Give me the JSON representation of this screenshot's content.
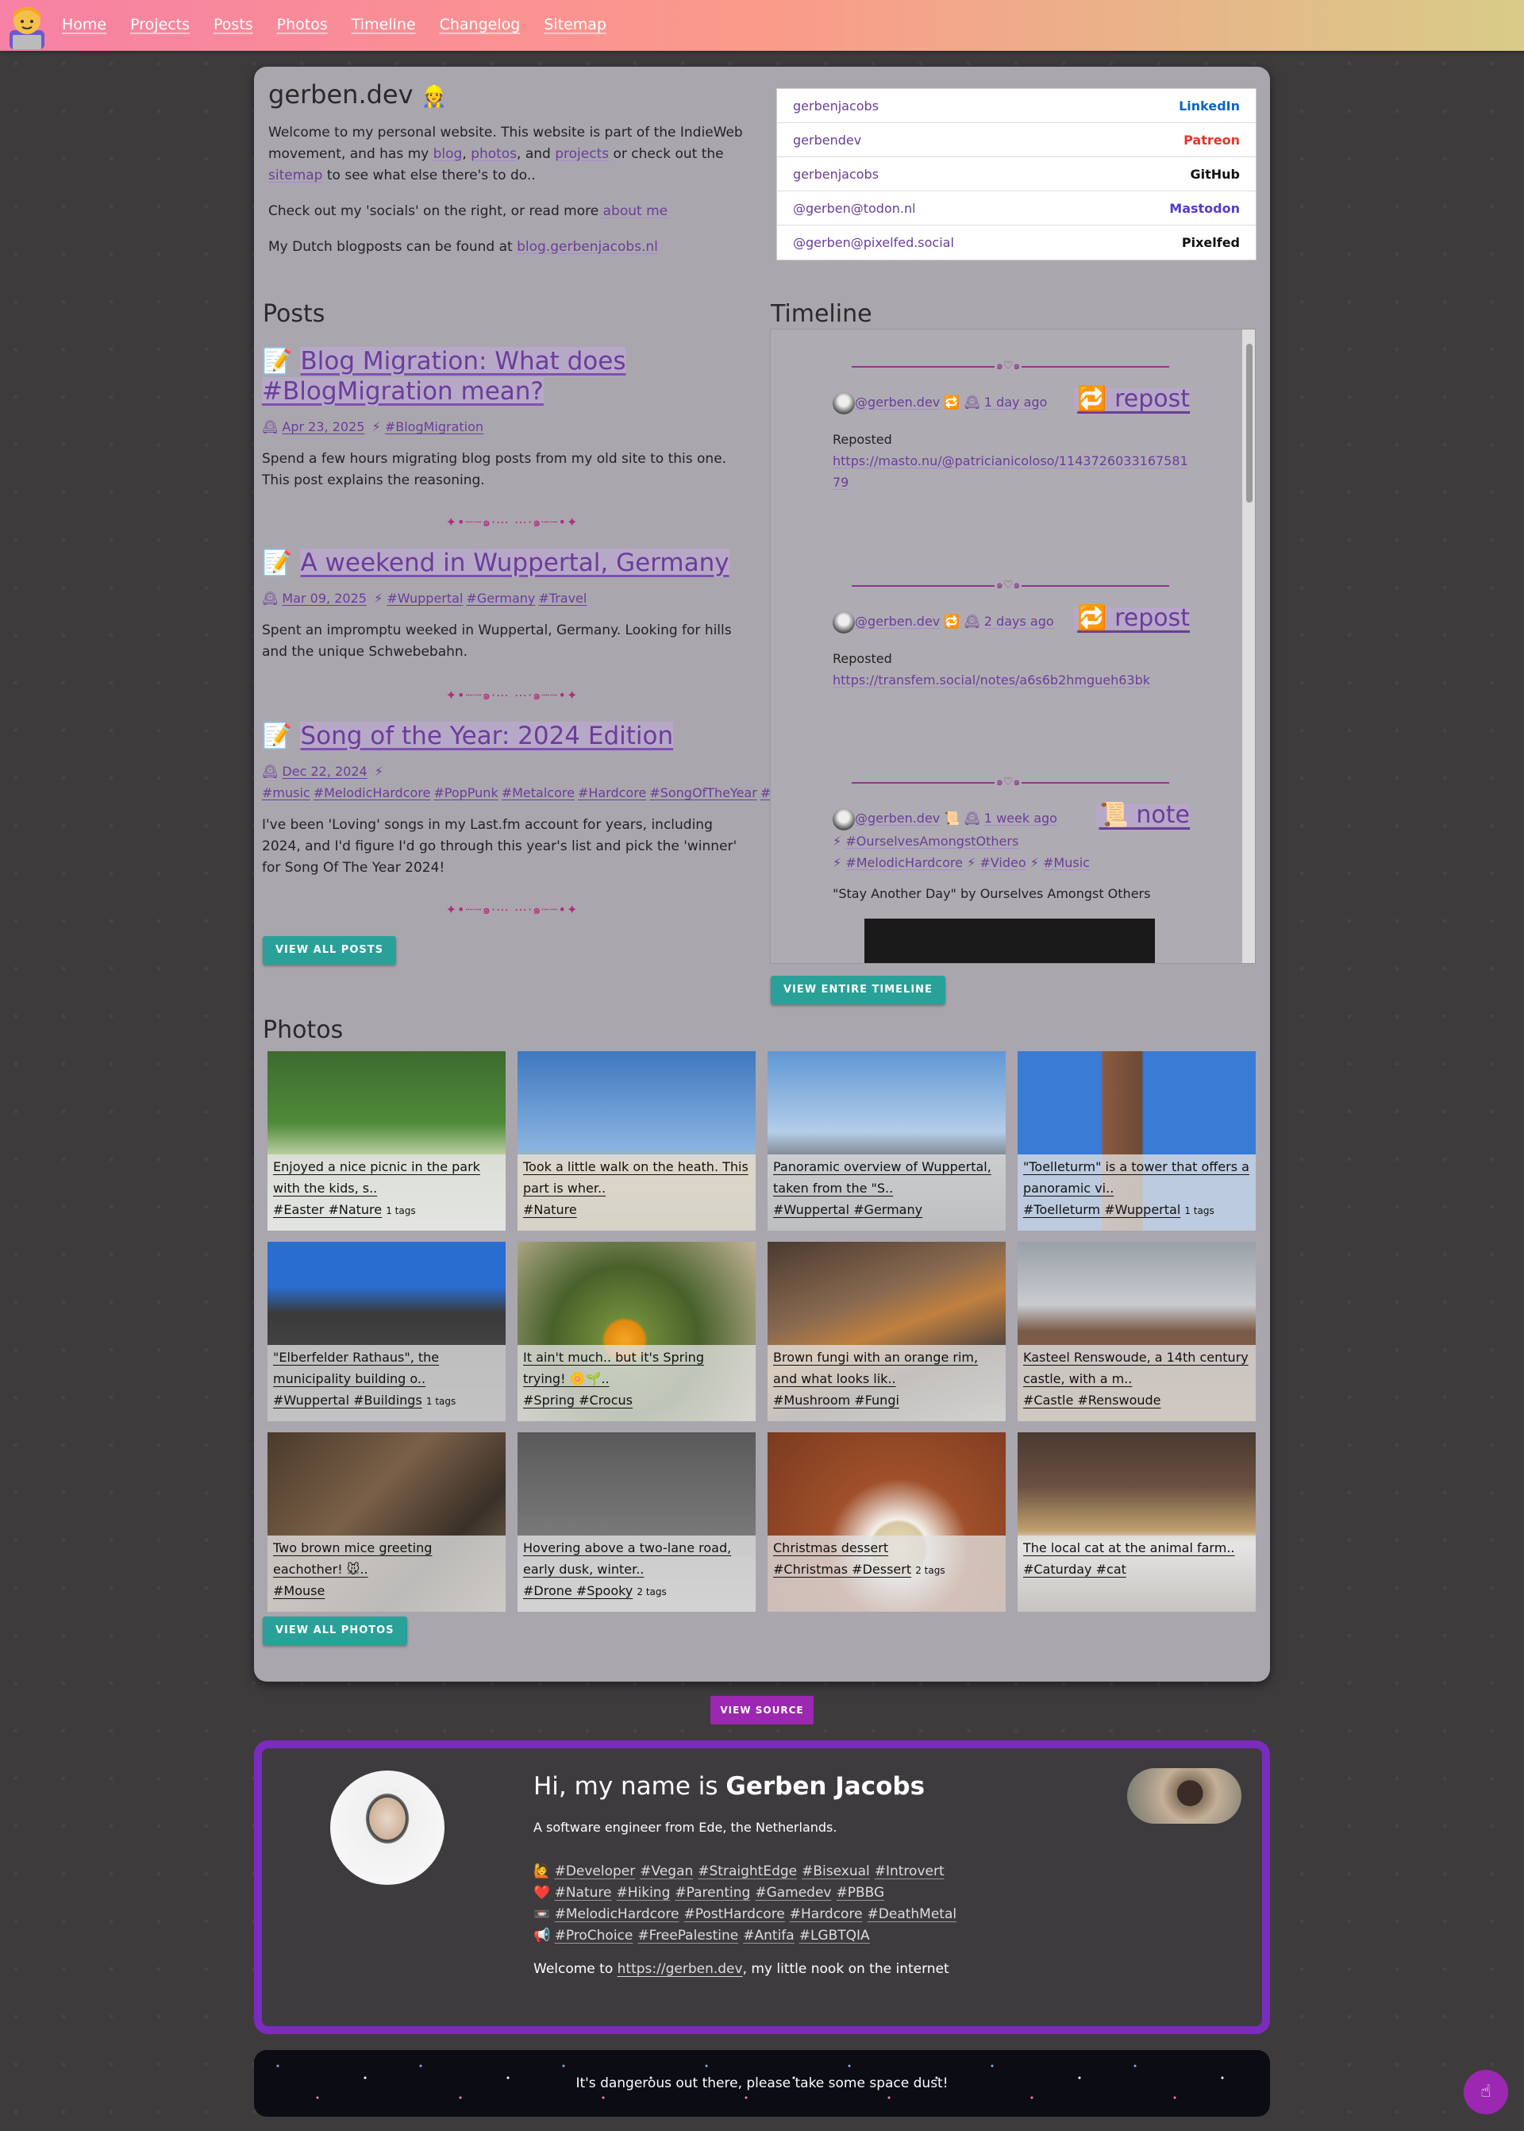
{
  "nav": {
    "items": [
      "Home",
      "Projects",
      "Posts",
      "Photos",
      "Timeline",
      "Changelog",
      "Sitemap"
    ]
  },
  "site": {
    "title": "gerben.dev",
    "title_icon": "construction-worker-emoji"
  },
  "intro": {
    "p1_a": "Welcome to my personal website. This website is part of the IndieWeb movement, and has my ",
    "blog": "blog",
    "sep1": ", ",
    "photos": "photos",
    "sep2": ", and ",
    "projects": "projects",
    "p1_b": " or check out the ",
    "sitemap": "sitemap",
    "p1_c": " to see what else there's to do..",
    "p2_a": "Check out my 'socials' on the right, or read more ",
    "about": "about me",
    "p3_a": "My Dutch blogposts can be found at ",
    "blog_nl": "blog.gerbenjacobs.nl"
  },
  "socials": [
    {
      "handle": "gerbenjacobs",
      "network": "LinkedIn",
      "color": "#0a66c2"
    },
    {
      "handle": "gerbendev",
      "network": "Patreon",
      "color": "#e8362a"
    },
    {
      "handle": "gerbenjacobs",
      "network": "GitHub",
      "color": "#111111"
    },
    {
      "handle": "@gerben@todon.nl",
      "network": "Mastodon",
      "color": "#563acc"
    },
    {
      "handle": "@gerben@pixelfed.social",
      "network": "Pixelfed",
      "color": "#111111"
    }
  ],
  "posts": {
    "title": "Posts",
    "items": [
      {
        "icon": "📝",
        "title": "Blog Migration: What does #BlogMigration mean?",
        "date": "Apr 23, 2025",
        "tags": [
          "#BlogMigration"
        ],
        "desc": "Spend a few hours migrating blog posts from my old site to this one. This post explains the reasoning."
      },
      {
        "icon": "📝",
        "title": "A weekend in Wuppertal, Germany",
        "date": "Mar 09, 2025",
        "tags": [
          "#Wuppertal",
          "#Germany",
          "#Travel"
        ],
        "desc": "Spent an impromptu weeked in Wuppertal, Germany. Looking for hills and the unique Schwebebahn."
      },
      {
        "icon": "📝",
        "title": "Song of the Year: 2024 Edition",
        "date": "Dec 22, 2024",
        "tags": [
          "#music",
          "#MelodicHardcore",
          "#PopPunk",
          "#Metalcore",
          "#Hardcore",
          "#SongOfTheYear",
          "#SOTY"
        ],
        "desc": "I've been 'Loving' songs in my Last.fm account for years, including 2024, and I'd figure I'd go through this year's list and pick the 'winner' for Song Of The Year 2024!"
      }
    ],
    "divider": "✦•┈┈๑⋅⋯ ⋯⋅๑┈┈•✦",
    "button": "VIEW ALL POSTS"
  },
  "timeline": {
    "title": "Timeline",
    "entries": [
      {
        "author": "@gerben.dev",
        "age": "1 day ago",
        "kind": "repost",
        "kind_icon": "🔁",
        "label": "Reposted",
        "link": "https://masto.nu/@patricianicoloso/114372603316758179"
      },
      {
        "author": "@gerben.dev",
        "age": "2 days ago",
        "kind": "repost",
        "kind_icon": "🔁",
        "label": "Reposted",
        "link": "https://transfem.social/notes/a6s6b2hmgueh63bk"
      },
      {
        "author": "@gerben.dev",
        "age": "1 week ago",
        "kind": "note",
        "kind_icon": "📜",
        "tags": [
          "#OurselvesAmongstOthers",
          "#MelodicHardcore",
          "#Video",
          "#Music"
        ],
        "text": "\"Stay Another Day\" by Ourselves Amongst Others"
      }
    ],
    "button": "VIEW ENTIRE TIMELINE"
  },
  "photos": {
    "title": "Photos",
    "items": [
      {
        "caption": "Enjoyed a nice picnic in the park with the kids, s..",
        "tags": "#Easter #Nature",
        "extra": "1 tags"
      },
      {
        "caption": "Took a little walk on the heath. This part is wher..",
        "tags": "#Nature",
        "extra": ""
      },
      {
        "caption": "Panoramic overview of Wuppertal, taken from the \"S..",
        "tags": "#Wuppertal #Germany",
        "extra": ""
      },
      {
        "caption": "\"Toelleturm\" is a tower that offers a panoramic vi..",
        "tags": "#Toelleturm #Wuppertal",
        "extra": "1 tags"
      },
      {
        "caption": "\"Elberfelder Rathaus\", the municipality building o..",
        "tags": "#Wuppertal #Buildings",
        "extra": "1 tags"
      },
      {
        "caption": "It ain't much.. but it's Spring trying! 🌼🌱..",
        "tags": "#Spring #Crocus",
        "extra": ""
      },
      {
        "caption": "Brown fungi with an orange rim, and what looks lik..",
        "tags": "#Mushroom #Fungi",
        "extra": ""
      },
      {
        "caption": "Kasteel Renswoude, a 14th century castle, with a m..",
        "tags": "#Castle #Renswoude",
        "extra": ""
      },
      {
        "caption": "Two brown mice greeting eachother! 🐭..",
        "tags": "#Mouse",
        "extra": ""
      },
      {
        "caption": "Hovering above a two-lane road, early dusk, winter..",
        "tags": "#Drone #Spooky",
        "extra": "2 tags"
      },
      {
        "caption": "Christmas dessert",
        "tags": "#Christmas #Dessert",
        "extra": "2 tags"
      },
      {
        "caption": "The local cat at the animal farm..",
        "tags": "#Caturday #cat",
        "extra": ""
      }
    ],
    "button": "VIEW ALL PHOTOS"
  },
  "view_source": "VIEW SOURCE",
  "about": {
    "greeting": "Hi, my name is ",
    "name": "Gerben Jacobs",
    "subtitle": "A software engineer from Ede, the Netherlands.",
    "rows": [
      {
        "icon": "🙋",
        "tags": [
          "#Developer",
          "#Vegan",
          "#StraightEdge",
          "#Bisexual",
          "#Introvert"
        ]
      },
      {
        "icon": "❤️",
        "tags": [
          "#Nature",
          "#Hiking",
          "#Parenting",
          "#Gamedev",
          "#PBBG"
        ]
      },
      {
        "icon": "📼",
        "tags": [
          "#MelodicHardcore",
          "#PostHardcore",
          "#Hardcore",
          "#DeathMetal"
        ]
      },
      {
        "icon": "📢",
        "tags": [
          "#ProChoice",
          "#FreePalestine",
          "#Antifa",
          "#LGBTQIA"
        ]
      }
    ],
    "welcome_a": "Welcome to ",
    "welcome_link": "https://gerben.dev",
    "welcome_b": ", my little nook on the internet"
  },
  "footer": {
    "text": "It's dangerous out there, please take some space dust!"
  },
  "hand_icon": "☝"
}
